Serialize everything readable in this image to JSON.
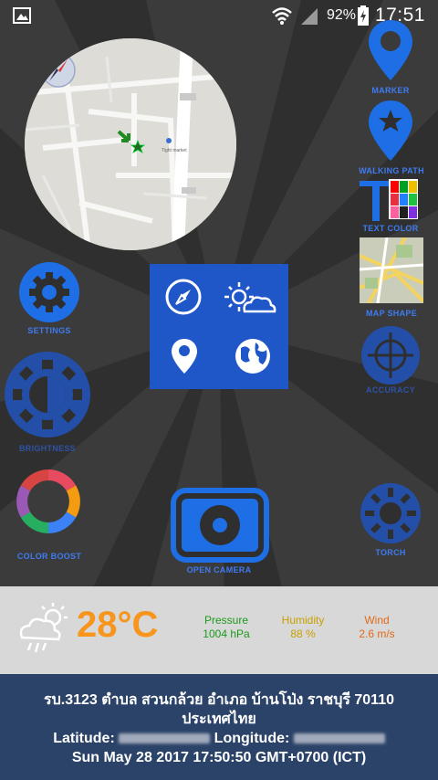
{
  "status_bar": {
    "battery": "92%",
    "time": "17:51"
  },
  "labels": {
    "marker": "MARKER",
    "walking_path": "WALKING PATH",
    "text_color": "TEXT COLOR",
    "map_shape": "MAP SHAPE",
    "accuracy": "ACCURACY",
    "settings": "SETTINGS",
    "brightness": "BRIGHTNESS",
    "color_boost": "COLOR BOOST",
    "open_camera": "OPEN CAMERA",
    "torch": "TORCH"
  },
  "map": {
    "poi_label": "Tight market"
  },
  "weather": {
    "temperature": "28°C",
    "pressure_label": "Pressure",
    "pressure_value": "1004 hPa",
    "humidity_label": "Humidity",
    "humidity_value": "88 %",
    "wind_label": "Wind",
    "wind_value": "2.6 m/s"
  },
  "address": {
    "line1": "รบ.3123 ตำบล สวนกล้วย อำเภอ บ้านโป่ง ราชบุรี 70110",
    "line2": "ประเทศไทย",
    "latitude_label": "Latitude:",
    "longitude_label": "Longitude:",
    "datetime": "Sun May 28 2017 17:50:50 GMT+0700 (ICT)"
  },
  "colors": {
    "accent_blue": "#1e6fe6",
    "temp_orange": "#f7951d",
    "pressure_green": "#1a9a1a",
    "humidity_yellow": "#c8a000",
    "wind_orange": "#e06a1a",
    "address_bg": "#2b4368"
  }
}
